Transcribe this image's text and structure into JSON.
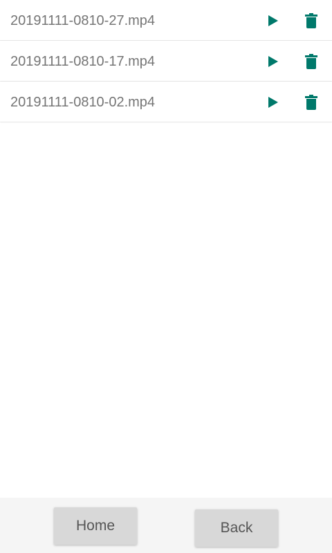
{
  "colors": {
    "accent": "#00796b",
    "text": "#757575"
  },
  "files": [
    {
      "name": "20191111-0810-27.mp4",
      "play_icon": "play-icon",
      "delete_icon": "trash-icon"
    },
    {
      "name": "20191111-0810-17.mp4",
      "play_icon": "play-icon",
      "delete_icon": "trash-icon"
    },
    {
      "name": "20191111-0810-02.mp4",
      "play_icon": "play-icon",
      "delete_icon": "trash-icon"
    }
  ],
  "footer": {
    "home_label": "Home",
    "back_label": "Back"
  }
}
